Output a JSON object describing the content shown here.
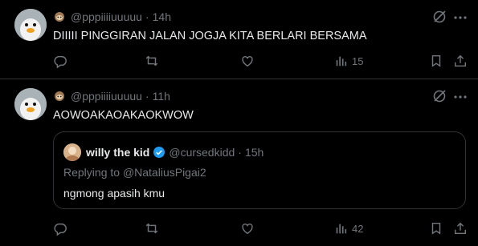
{
  "tweets": [
    {
      "handle": "@pppiiiiuuuuu",
      "separator": "·",
      "time": "14h",
      "text": "DIIIII PINGGIRAN JALAN JOGJA KITA BERLARI BERSAMA",
      "views_count": "15",
      "icons": {
        "avatar": "avatar",
        "emoji": "sloth-emoji"
      }
    },
    {
      "handle": "@pppiiiiuuuuu",
      "separator": "·",
      "time": "11h",
      "text": "AOWOAKAOAKAOKWOW",
      "views_count": "42",
      "quote": {
        "name": "willy the kid",
        "handle": "@cursedkidd",
        "separator": "·",
        "time": "15h",
        "replying_prefix": "Replying to ",
        "replying_to": "@NataliusPigai2",
        "text": "ngmong apasih kmu"
      }
    }
  ],
  "colors": {
    "background": "#000000",
    "text": "#e7e9ea",
    "muted": "#71767b",
    "divider": "#2f3336",
    "verified": "#1d9bf0"
  }
}
